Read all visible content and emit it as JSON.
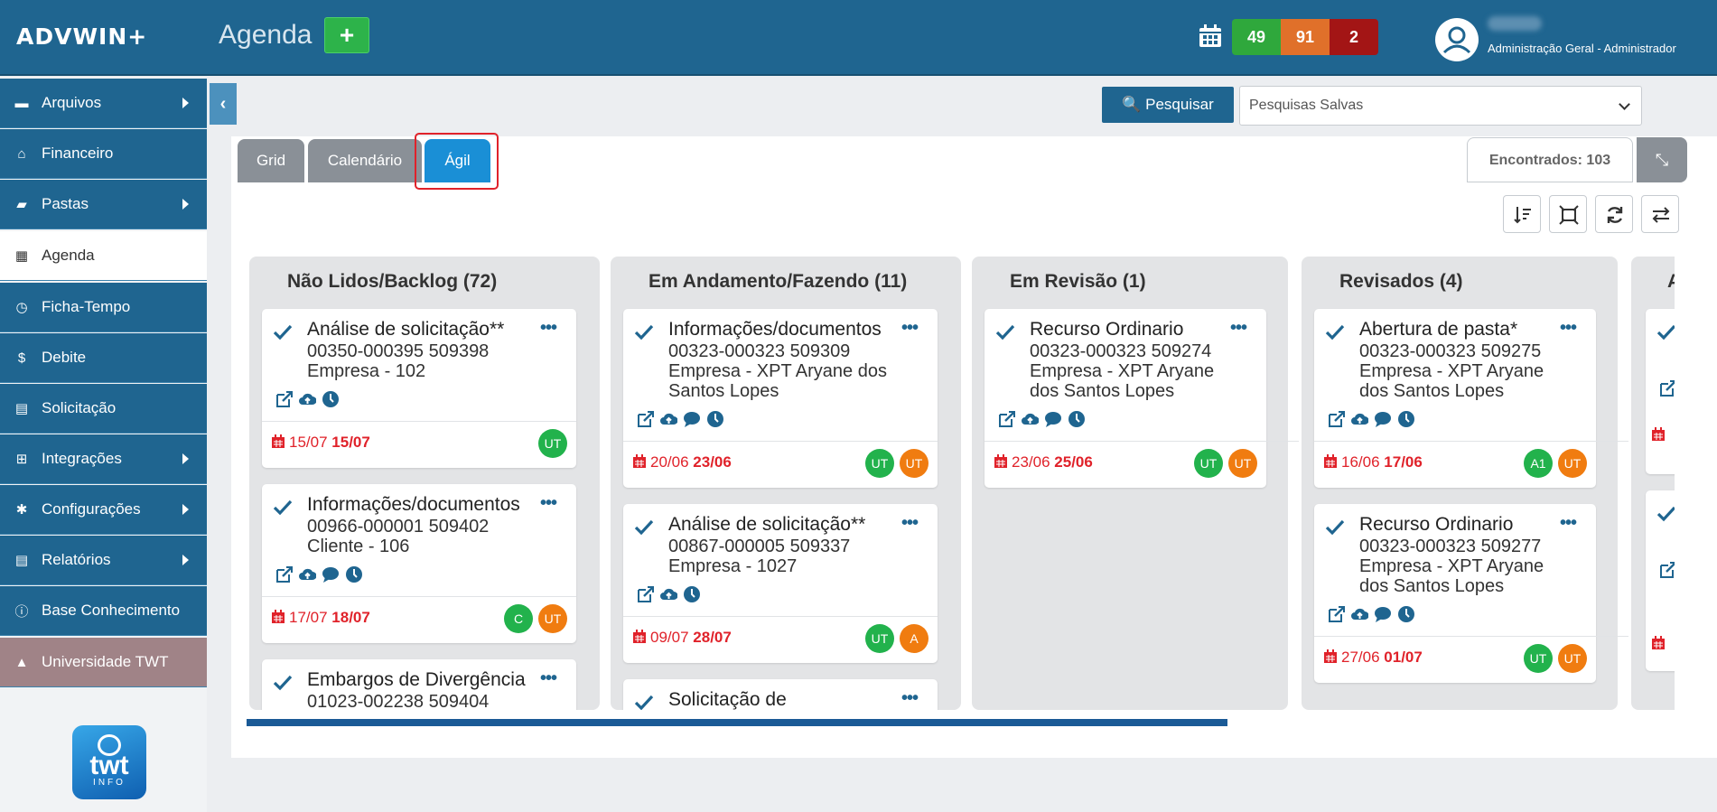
{
  "header": {
    "logo": "ADVWIN+",
    "page_title": "Agenda",
    "add_label": "+",
    "counts": [
      "49",
      "91",
      "2"
    ],
    "user_role": "Administração Geral - Administrador"
  },
  "sidebar": {
    "items": [
      {
        "label": "Arquivos",
        "icon": "archive-icon",
        "arrow": true
      },
      {
        "label": "Financeiro",
        "icon": "bank-icon",
        "arrow": false
      },
      {
        "label": "Pastas",
        "icon": "folder-icon",
        "arrow": true
      },
      {
        "label": "Agenda",
        "icon": "calendar-icon",
        "arrow": false
      },
      {
        "label": "Ficha-Tempo",
        "icon": "clock-icon",
        "arrow": false
      },
      {
        "label": "Debite",
        "icon": "money-icon",
        "arrow": false
      },
      {
        "label": "Solicitação",
        "icon": "request-icon",
        "arrow": false
      },
      {
        "label": "Integrações",
        "icon": "sitemap-icon",
        "arrow": true
      },
      {
        "label": "Configurações",
        "icon": "cogs-icon",
        "arrow": true
      },
      {
        "label": "Relatórios",
        "icon": "report-icon",
        "arrow": true
      },
      {
        "label": "Base Conhecimento",
        "icon": "info-icon",
        "arrow": false
      },
      {
        "label": "Universidade TWT",
        "icon": "graduation-icon",
        "arrow": false
      }
    ],
    "brand_logo_top": "twt",
    "brand_logo_bottom": "INFO"
  },
  "search": {
    "button_label": "Pesquisar",
    "saved_placeholder": "Pesquisas Salvas"
  },
  "tabs": [
    "Grid",
    "Calendário",
    "Ágil"
  ],
  "found_label": "Encontrados: 103",
  "board": {
    "columns": [
      {
        "title": "Não Lidos/Backlog (72)",
        "cards": [
          {
            "title": "Análise de solicitação**",
            "lines": [
              "00350-000395 509398",
              "Empresa - 102"
            ],
            "icons": [
              "edit-icon",
              "cloud-upload-icon",
              "clock-icon"
            ],
            "date_from": "15/07",
            "date_to": "15/07",
            "avatars": [
              {
                "text": "UT",
                "color": "g"
              }
            ]
          },
          {
            "title": "Informações/documentos",
            "lines": [
              "00966-000001 509402",
              "Cliente - 106"
            ],
            "icons": [
              "edit-icon",
              "cloud-upload-icon",
              "comment-icon",
              "clock-icon"
            ],
            "date_from": "17/07",
            "date_to": "18/07",
            "avatars": [
              {
                "text": "C",
                "color": "g"
              },
              {
                "text": "UT",
                "color": "o"
              }
            ]
          },
          {
            "title": "Embargos de Divergência",
            "lines": [
              "01023-002238 509404"
            ],
            "icons": [],
            "date_from": "",
            "date_to": "",
            "avatars": []
          }
        ]
      },
      {
        "title": "Em Andamento/Fazendo (11)",
        "cards": [
          {
            "title": "Informações/documentos",
            "lines": [
              "00323-000323 509309",
              "Empresa - XPT Aryane dos",
              "Santos Lopes"
            ],
            "icons": [
              "edit-icon",
              "cloud-upload-icon",
              "comment-icon",
              "clock-icon"
            ],
            "date_from": "20/06",
            "date_to": "23/06",
            "avatars": [
              {
                "text": "UT",
                "color": "g"
              },
              {
                "text": "UT",
                "color": "o"
              }
            ]
          },
          {
            "title": "Análise de solicitação**",
            "lines": [
              "00867-000005 509337",
              "Empresa - 1027"
            ],
            "icons": [
              "edit-icon",
              "cloud-upload-icon",
              "clock-icon"
            ],
            "date_from": "09/07",
            "date_to": "28/07",
            "avatars": [
              {
                "text": "UT",
                "color": "g"
              },
              {
                "text": "A",
                "color": "o"
              }
            ]
          },
          {
            "title": "Solicitação de",
            "lines": [],
            "icons": [],
            "date_from": "",
            "date_to": "",
            "avatars": []
          }
        ]
      },
      {
        "title": "Em Revisão (1)",
        "cards": [
          {
            "title": "Recurso Ordinario",
            "lines": [
              "00323-000323 509274",
              "Empresa - XPT Aryane",
              "dos Santos Lopes"
            ],
            "icons": [
              "edit-icon",
              "cloud-upload-icon",
              "comment-icon",
              "clock-icon"
            ],
            "date_from": "23/06",
            "date_to": "25/06",
            "avatars": [
              {
                "text": "UT",
                "color": "g"
              },
              {
                "text": "UT",
                "color": "o"
              }
            ]
          }
        ]
      },
      {
        "title": "Revisados (4)",
        "cards": [
          {
            "title": "Abertura de pasta*",
            "lines": [
              "00323-000323 509275",
              "Empresa - XPT Aryane",
              "dos Santos Lopes"
            ],
            "icons": [
              "edit-icon",
              "cloud-upload-icon",
              "comment-icon",
              "clock-icon"
            ],
            "date_from": "16/06",
            "date_to": "17/06",
            "avatars": [
              {
                "text": "A1",
                "color": "g"
              },
              {
                "text": "UT",
                "color": "o"
              }
            ]
          },
          {
            "title": "Recurso Ordinario",
            "lines": [
              "00323-000323 509277",
              "Empresa - XPT Aryane",
              "dos Santos Lopes"
            ],
            "icons": [
              "edit-icon",
              "cloud-upload-icon",
              "comment-icon",
              "clock-icon"
            ],
            "date_from": "27/06",
            "date_to": "01/07",
            "avatars": [
              {
                "text": "UT",
                "color": "g"
              },
              {
                "text": "UT",
                "color": "o"
              }
            ]
          }
        ]
      },
      {
        "title": "A",
        "cards": [
          {
            "title": "",
            "lines": [],
            "icons": [
              "edit-icon"
            ],
            "date_from": "",
            "date_to": "",
            "avatars": []
          },
          {
            "title": "",
            "lines": [],
            "icons": [
              "edit-icon"
            ],
            "date_from": "",
            "date_to": "",
            "avatars": []
          }
        ]
      }
    ]
  },
  "colors": {
    "header": "#1f6590",
    "accent": "#1a8fd6",
    "danger": "#e0222a",
    "success": "#22b24c",
    "warning": "#f07c10"
  }
}
